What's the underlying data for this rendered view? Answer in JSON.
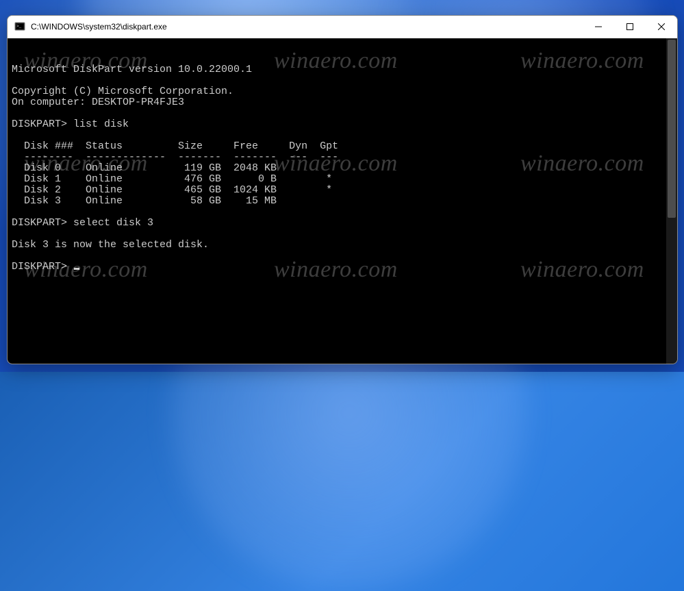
{
  "watermark": "winaero.com",
  "window": {
    "title": "C:\\WINDOWS\\system32\\diskpart.exe"
  },
  "terminal": {
    "version_line": "Microsoft DiskPart version 10.0.22000.1",
    "copyright_line": "Copyright (C) Microsoft Corporation.",
    "computer_line": "On computer: DESKTOP-PR4FJE3",
    "prompt": "DISKPART>",
    "cmd1": "list disk",
    "header": "  Disk ###  Status         Size     Free     Dyn  Gpt",
    "divider": "  --------  -------------  -------  -------  ---  ---",
    "rows": [
      "  Disk 0    Online          119 GB  2048 KB",
      "  Disk 1    Online          476 GB      0 B        *",
      "  Disk 2    Online          465 GB  1024 KB        *",
      "  Disk 3    Online           58 GB    15 MB"
    ],
    "cmd2": "select disk 3",
    "result": "Disk 3 is now the selected disk."
  }
}
